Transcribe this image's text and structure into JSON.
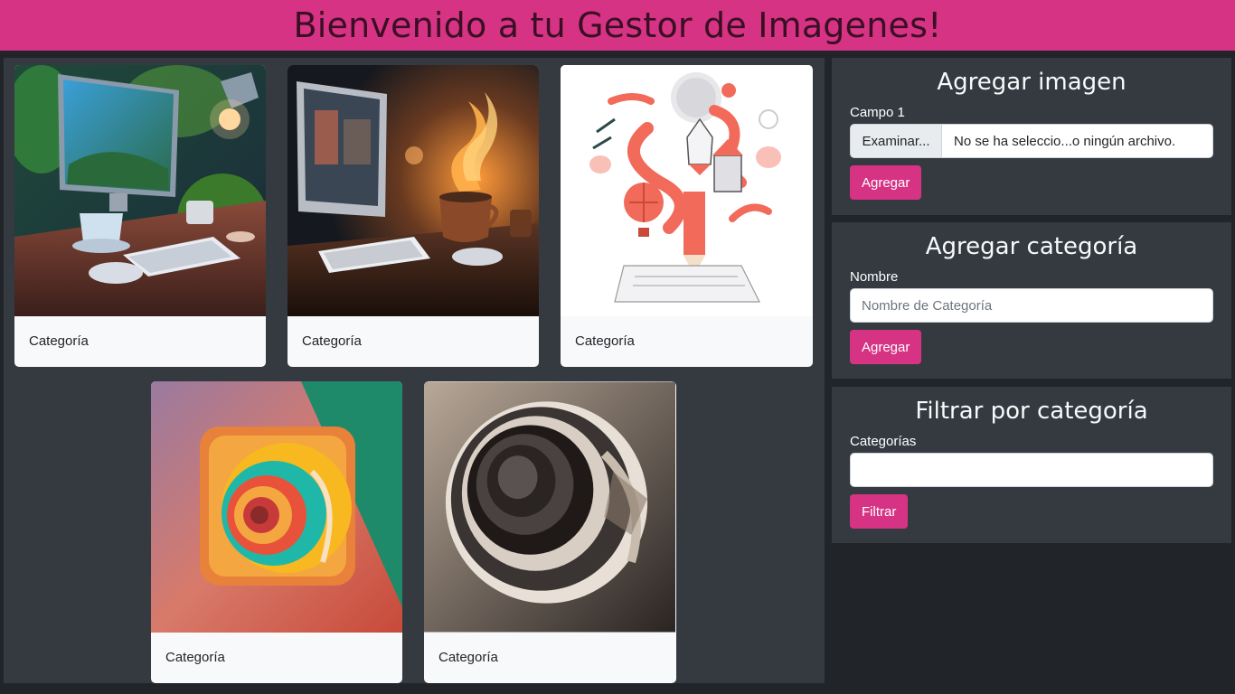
{
  "header": {
    "title": "Bienvenido a tu Gestor de Imagenes!"
  },
  "gallery": {
    "cards": [
      {
        "caption": "Categoría"
      },
      {
        "caption": "Categoría"
      },
      {
        "caption": "Categoría"
      },
      {
        "caption": "Categoría"
      },
      {
        "caption": "Categoría"
      }
    ]
  },
  "add_image": {
    "title": "Agregar imagen",
    "field_label": "Campo 1",
    "browse_label": "Examinar...",
    "file_status": "No se ha seleccio...o ningún archivo.",
    "submit_label": "Agregar"
  },
  "add_category": {
    "title": "Agregar categoría",
    "field_label": "Nombre",
    "placeholder": "Nombre de Categoría",
    "submit_label": "Agregar"
  },
  "filter": {
    "title": "Filtrar por categoría",
    "field_label": "Categorías",
    "value": "",
    "submit_label": "Filtrar"
  },
  "colors": {
    "accent": "#d63384",
    "panel": "#343a40",
    "background": "#212529"
  }
}
